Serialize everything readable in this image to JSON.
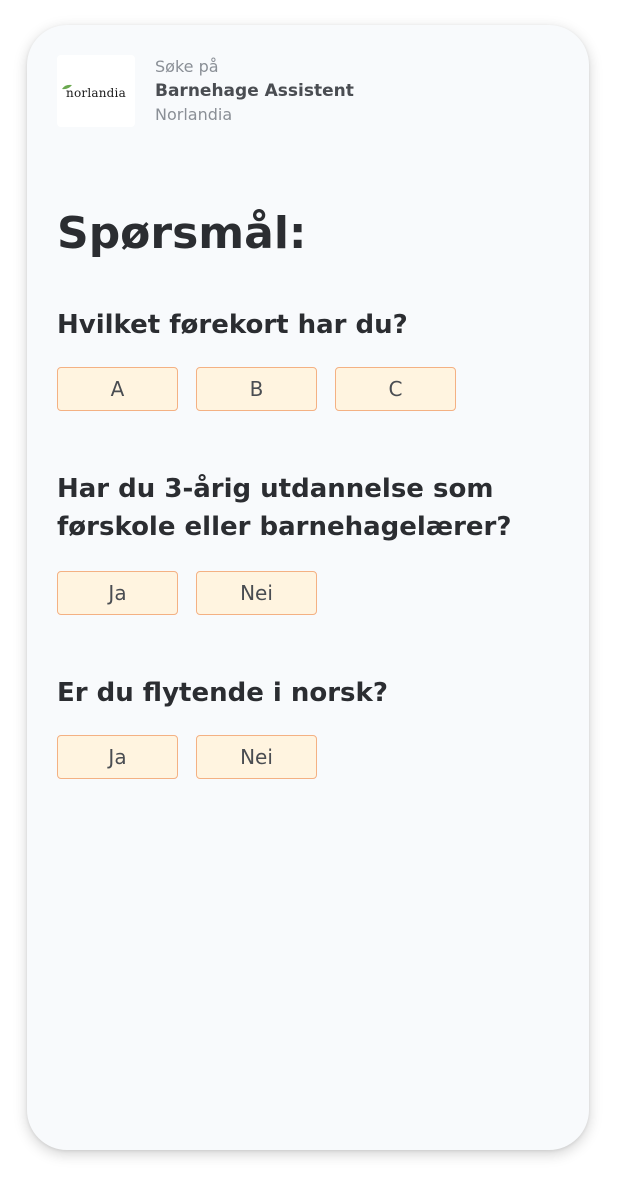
{
  "header": {
    "logo_text": "norlandia",
    "subtitle": "Søke på",
    "title": "Barnehage Assistent",
    "company": "Norlandia"
  },
  "page": {
    "title": "Spørsmål:"
  },
  "questions": [
    {
      "text": "Hvilket førekort har du?",
      "options": [
        "A",
        "B",
        "C"
      ]
    },
    {
      "text": "Har du 3-årig utdannelse som førskole eller barnehagelærer?",
      "options": [
        "Ja",
        "Nei"
      ]
    },
    {
      "text": "Er du flytende i norsk?",
      "options": [
        "Ja",
        "Nei"
      ]
    }
  ],
  "colors": {
    "option_fill": "#fff4e0",
    "option_border": "#f4b183",
    "logo_leaf": "#6aa84f"
  }
}
